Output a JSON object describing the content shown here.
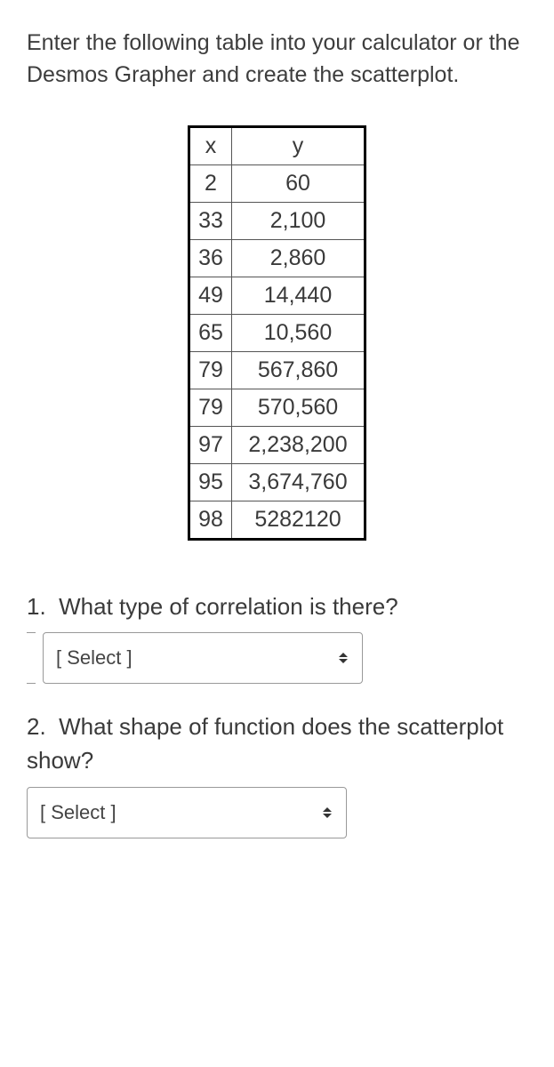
{
  "intro": "Enter the following table into your calculator or the Desmos Grapher and create the scatterplot.",
  "table": {
    "headers": {
      "x": "x",
      "y": "y"
    },
    "rows": [
      {
        "x": "2",
        "y": "60"
      },
      {
        "x": "33",
        "y": "2,100"
      },
      {
        "x": "36",
        "y": "2,860"
      },
      {
        "x": "49",
        "y": "14,440"
      },
      {
        "x": "65",
        "y": "10,560"
      },
      {
        "x": "79",
        "y": "567,860"
      },
      {
        "x": "79",
        "y": "570,560"
      },
      {
        "x": "97",
        "y": "2,238,200"
      },
      {
        "x": "95",
        "y": "3,674,760"
      },
      {
        "x": "98",
        "y": "5282120"
      }
    ]
  },
  "questions": {
    "q1": {
      "number": "1.",
      "text": "What type of correlation is there?",
      "placeholder": "[ Select ]"
    },
    "q2": {
      "number": "2.",
      "text": "What shape of function does the scatterplot show?",
      "placeholder": "[ Select ]"
    }
  }
}
